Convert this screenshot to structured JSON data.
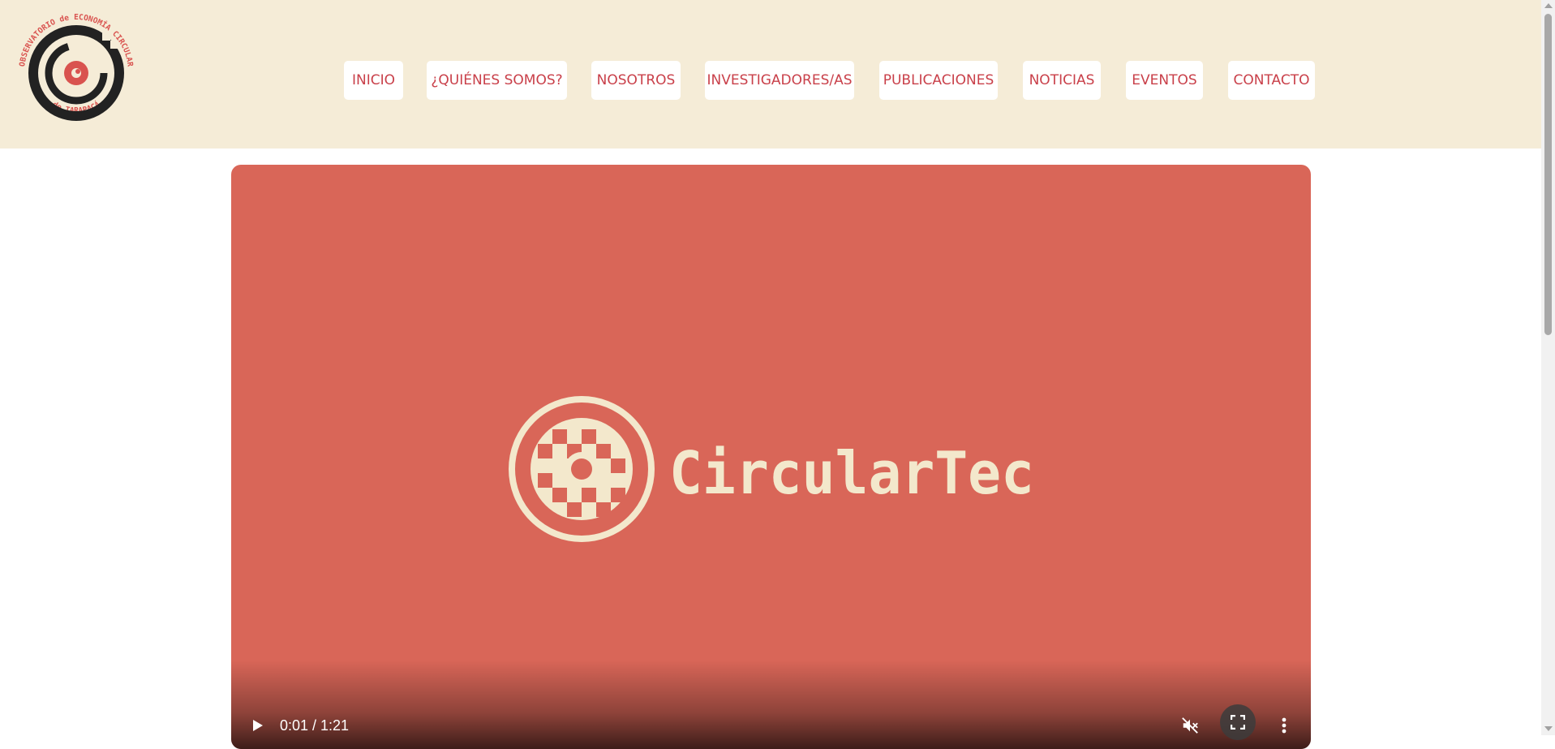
{
  "logo": {
    "top_text": "OBSERVATORIO de ECONOMÍA CIRCULAR",
    "bottom_text": "de TARAPACÁ",
    "colors": {
      "red": "#d9534f",
      "dark": "#222222"
    }
  },
  "nav": {
    "items": [
      {
        "label": "INICIO"
      },
      {
        "label": "¿QUIÉNES SOMOS?"
      },
      {
        "label": "NOSOTROS"
      },
      {
        "label": "INVESTIGADORES/AS"
      },
      {
        "label": "PUBLICACIONES"
      },
      {
        "label": "NOTICIAS"
      },
      {
        "label": "EVENTOS"
      },
      {
        "label": "CONTACTO"
      }
    ]
  },
  "video": {
    "brand_text": "CircularTec",
    "current_time": "0:01",
    "duration": "1:21",
    "time_display": "0:01 / 1:21",
    "muted": true,
    "icons": [
      "play-icon",
      "mute-icon",
      "fullscreen-icon",
      "more-options-icon"
    ]
  },
  "colors": {
    "header_bg": "#f5ecd7",
    "nav_text": "#c9404a",
    "video_bg": "#d96658",
    "brand_cream": "#f3e8cc"
  }
}
